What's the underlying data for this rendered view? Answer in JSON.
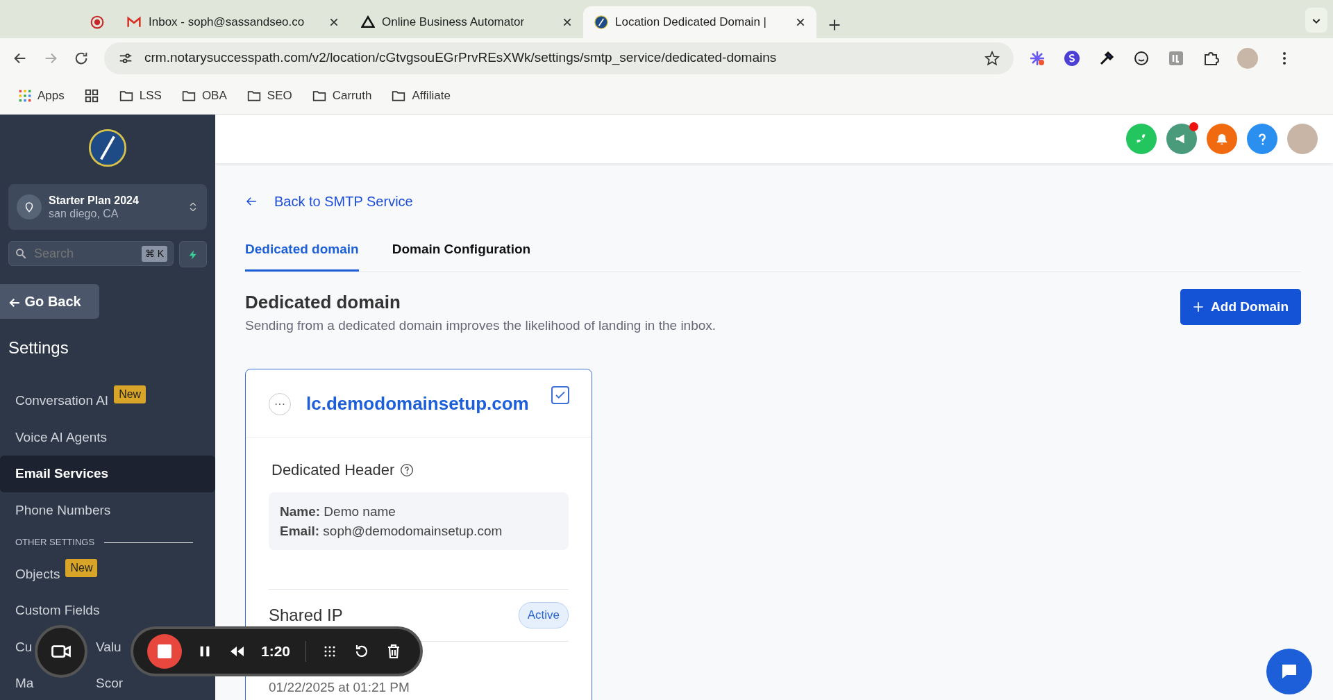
{
  "browser": {
    "tabs": [
      {
        "kind": "record",
        "selected": false
      },
      {
        "kind": "mail",
        "title": "Inbox - soph@sassandseo.co",
        "selected": false
      },
      {
        "kind": "triangle",
        "title": "Online Business Automator",
        "selected": false
      },
      {
        "kind": "compass",
        "title": "Location Dedicated Domain |",
        "selected": true
      }
    ],
    "url": "crm.notarysuccesspath.com/v2/location/cGtvgsouEGrPrvREsXWk/settings/smtp_service/dedicated-domains",
    "bookmarks": [
      {
        "kind": "apps",
        "label": "Apps"
      },
      {
        "kind": "grid"
      },
      {
        "kind": "folder",
        "label": "LSS"
      },
      {
        "kind": "folder",
        "label": "OBA"
      },
      {
        "kind": "folder",
        "label": "SEO"
      },
      {
        "kind": "folder",
        "label": "Carruth"
      },
      {
        "kind": "folder",
        "label": "Affiliate"
      }
    ]
  },
  "sidebar": {
    "location": {
      "name": "Starter Plan 2024",
      "place": "san diego, CA"
    },
    "search": {
      "placeholder": "Search",
      "shortcut": "⌘ K"
    },
    "go_back": "Go Back",
    "title": "Settings",
    "items": [
      {
        "kind": "item",
        "label": "Conversation AI",
        "badge": "New",
        "selected": false
      },
      {
        "kind": "item",
        "label": "Voice AI Agents",
        "selected": false
      },
      {
        "kind": "item",
        "label": "Email Services",
        "selected": true
      },
      {
        "kind": "item",
        "label": "Phone Numbers",
        "selected": false
      },
      {
        "kind": "section",
        "label": "OTHER SETTINGS"
      },
      {
        "kind": "item",
        "label": "Objects",
        "badge": "New",
        "selected": false
      },
      {
        "kind": "item",
        "label": "Custom Fields",
        "selected": false
      },
      {
        "kind": "item",
        "label": "Cu",
        "tail": "Valu",
        "selected": false
      },
      {
        "kind": "item",
        "label": "Ma",
        "tail": "Scor",
        "selected": false
      }
    ]
  },
  "main": {
    "back_link": "Back to SMTP Service",
    "tabs": [
      {
        "label": "Dedicated domain",
        "selected": true
      },
      {
        "label": "Domain Configuration",
        "selected": false
      }
    ],
    "title": "Dedicated domain",
    "description": "Sending from a dedicated domain improves the likelihood of landing in the inbox.",
    "add_button": "Add Domain",
    "card": {
      "menu_glyph": "···",
      "domain": "lc.demodomainsetup.com",
      "checked": true,
      "header_title": "Dedicated Header",
      "name_label": "Name:",
      "name_value": "Demo name",
      "email_label": "Email:",
      "email_value": "soph@demodomainsetup.com",
      "shared_ip": "Shared IP",
      "status": "Active",
      "date": "01/22/2025 at 01:21 PM"
    }
  },
  "recorder": {
    "time": "1:20"
  }
}
